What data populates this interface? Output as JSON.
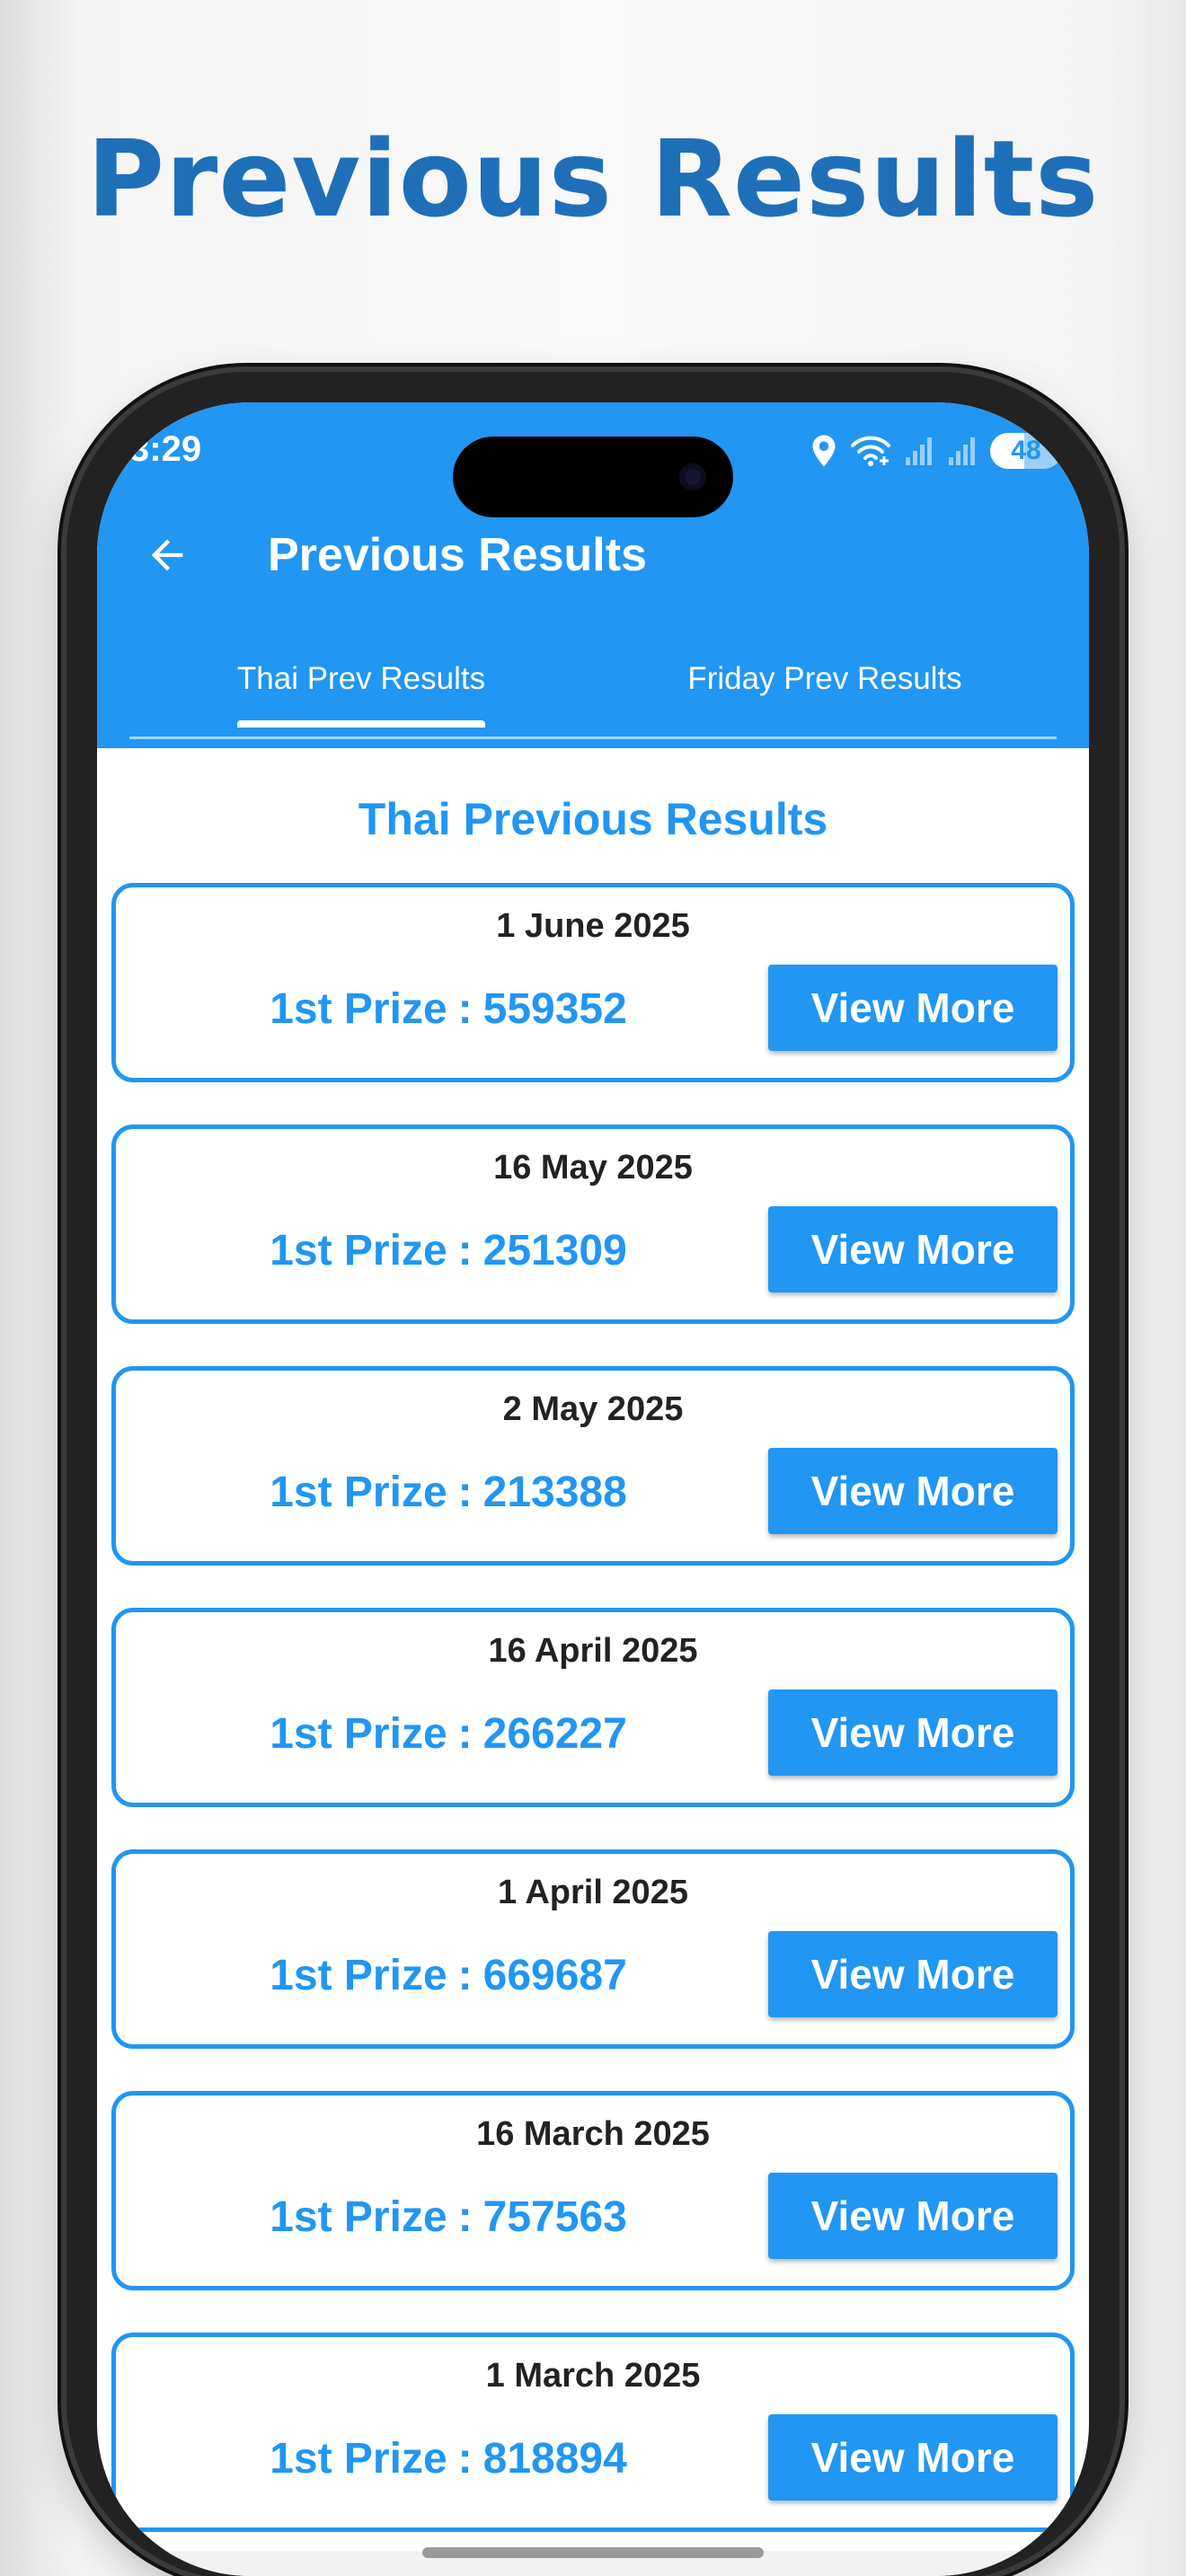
{
  "headline": "Previous Results",
  "status_bar": {
    "time": "3:29",
    "battery": "48",
    "battery_level_percent": 48
  },
  "app_bar": {
    "title": "Previous Results",
    "back_icon": "arrow-left-icon"
  },
  "tabs": [
    {
      "label": "Thai Prev Results",
      "selected": true
    },
    {
      "label": "Friday Prev Results",
      "selected": false
    }
  ],
  "section_title": "Thai Previous Results",
  "results": [
    {
      "date": "1 June 2025",
      "prize_label": "1st Prize",
      "separator": ":",
      "number": "559352",
      "button": "View More"
    },
    {
      "date": "16 May 2025",
      "prize_label": "1st Prize",
      "separator": ":",
      "number": "251309",
      "button": "View More"
    },
    {
      "date": "2 May 2025",
      "prize_label": "1st Prize",
      "separator": ":",
      "number": "213388",
      "button": "View More"
    },
    {
      "date": "16 April 2025",
      "prize_label": "1st Prize",
      "separator": ":",
      "number": "266227",
      "button": "View More"
    },
    {
      "date": "1 April 2025",
      "prize_label": "1st Prize",
      "separator": ":",
      "number": "669687",
      "button": "View More"
    },
    {
      "date": "16 March 2025",
      "prize_label": "1st Prize",
      "separator": ":",
      "number": "757563",
      "button": "View More"
    },
    {
      "date": "1 March 2025",
      "prize_label": "1st Prize",
      "separator": ":",
      "number": "818894",
      "button": "View More"
    }
  ],
  "colors": {
    "primary": "#2196f3",
    "headline": "#1f6fb8",
    "date_text": "#222222"
  }
}
